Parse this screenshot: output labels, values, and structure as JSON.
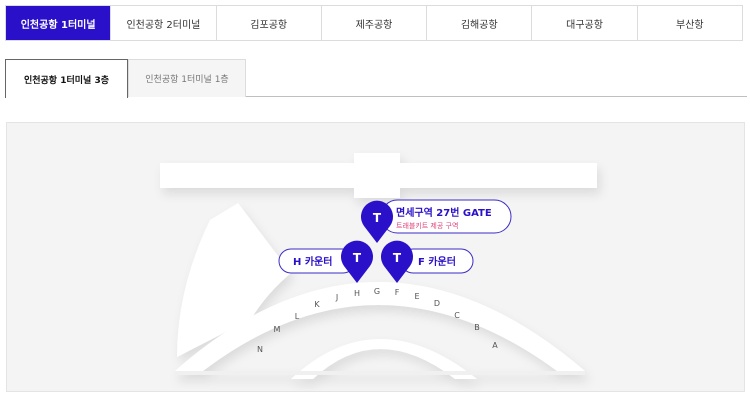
{
  "airport_tabs": [
    {
      "label": "인천공항 1터미널",
      "active": true
    },
    {
      "label": "인천공항 2터미널",
      "active": false
    },
    {
      "label": "김포공항",
      "active": false
    },
    {
      "label": "제주공항",
      "active": false
    },
    {
      "label": "김해공항",
      "active": false
    },
    {
      "label": "대구공항",
      "active": false
    },
    {
      "label": "부산항",
      "active": false
    }
  ],
  "floor_tabs": [
    {
      "label": "인천공항 1터미널 3층",
      "active": true
    },
    {
      "label": "인천공항 1터미널 1층",
      "active": false
    }
  ],
  "map": {
    "counter_letters": [
      "N",
      "M",
      "L",
      "K",
      "J",
      "H",
      "G",
      "F",
      "E",
      "D",
      "C",
      "B",
      "A"
    ],
    "markers": {
      "gate": {
        "title": "면세구역 27번 GATE",
        "subtitle": "트래블키트 제공 구역",
        "pin_letter": "T"
      },
      "h_counter": {
        "title": "H 카운터",
        "pin_letter": "T"
      },
      "f_counter": {
        "title": "F 카운터",
        "pin_letter": "T"
      }
    }
  },
  "colors": {
    "accent": "#2a10c8",
    "sub_label": "#e0457a"
  }
}
